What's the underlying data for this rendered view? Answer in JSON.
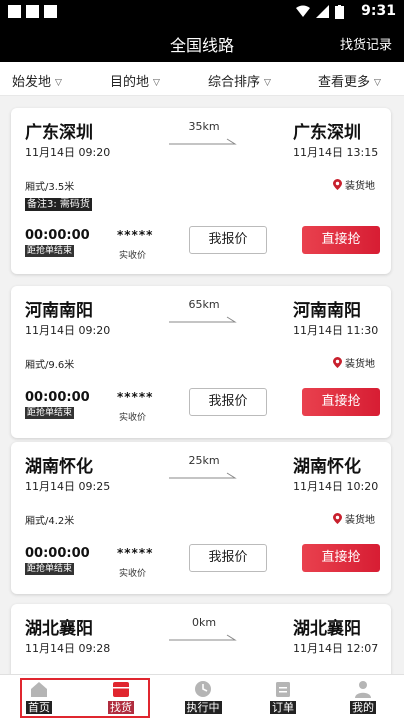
{
  "status_bar": {
    "time": "9:31"
  },
  "header": {
    "title": "全国线路",
    "right_link": "找货记录"
  },
  "filters": [
    {
      "label": "始发地"
    },
    {
      "label": "目的地"
    },
    {
      "label": "综合排序"
    },
    {
      "label": "查看更多"
    }
  ],
  "cards": [
    {
      "from": "广东深圳",
      "from_time": "11月14日 09:20",
      "distance": "35km",
      "to": "广东深圳",
      "to_time": "11月14日 13:15",
      "spec": "厢式/3.5米",
      "load_label": "装货地",
      "note": "备注3: 需码货",
      "countdown": "00:00:00",
      "countdown_label": "距抢单结束",
      "price": "*****",
      "price_label": "实收价",
      "quote_btn": "我报价",
      "grab_btn": "直接抢"
    },
    {
      "from": "河南南阳",
      "from_time": "11月14日 09:20",
      "distance": "65km",
      "to": "河南南阳",
      "to_time": "11月14日 11:30",
      "spec": "厢式/9.6米",
      "load_label": "装货地",
      "note": "",
      "countdown": "00:00:00",
      "countdown_label": "距抢单结束",
      "price": "*****",
      "price_label": "实收价",
      "quote_btn": "我报价",
      "grab_btn": "直接抢"
    },
    {
      "from": "湖南怀化",
      "from_time": "11月14日 09:25",
      "distance": "25km",
      "to": "湖南怀化",
      "to_time": "11月14日 10:20",
      "spec": "厢式/4.2米",
      "load_label": "装货地",
      "note": "",
      "countdown": "00:00:00",
      "countdown_label": "距抢单结束",
      "price": "*****",
      "price_label": "实收价",
      "quote_btn": "我报价",
      "grab_btn": "直接抢"
    },
    {
      "from": "湖北襄阳",
      "from_time": "11月14日 09:28",
      "distance": "0km",
      "to": "湖北襄阳",
      "to_time": "11月14日 12:07"
    }
  ],
  "tabbar": [
    {
      "label": "首页",
      "icon": "home-icon"
    },
    {
      "label": "找货",
      "icon": "cargo-box-icon",
      "active": true
    },
    {
      "label": "执行中",
      "icon": "clock-icon"
    },
    {
      "label": "订单",
      "icon": "clipboard-icon"
    },
    {
      "label": "我的",
      "icon": "user-icon"
    }
  ],
  "colors": {
    "accent": "#e0262f",
    "header_bg": "#000000",
    "grab_button": "#e5333f"
  }
}
